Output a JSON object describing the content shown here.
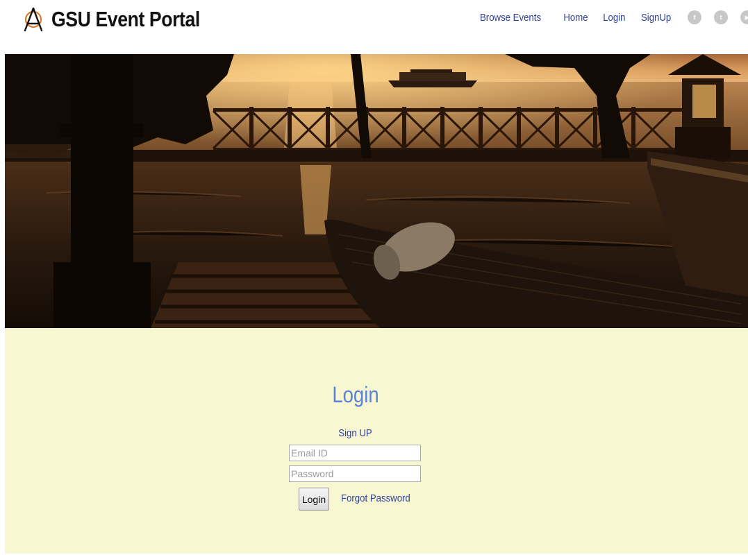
{
  "header": {
    "brand_title": "GSU Event Portal",
    "logo_icon": "compass-a-icon",
    "nav": [
      {
        "label": "Browse Events"
      },
      {
        "label": "Home"
      },
      {
        "label": "Login"
      },
      {
        "label": "SignUp"
      }
    ],
    "social": [
      {
        "icon": "facebook-icon",
        "glyph": "f"
      },
      {
        "icon": "twitter-icon",
        "glyph": "t"
      },
      {
        "icon": "youtube-icon",
        "glyph": "▶"
      }
    ]
  },
  "hero": {
    "image": "sunset-pool-photo"
  },
  "login": {
    "title": "Login",
    "signup_label": "Sign UP",
    "email_placeholder": "Email ID",
    "password_placeholder": "Password",
    "login_button": "Login",
    "forgot_label": "Forgot Password"
  },
  "colors": {
    "nav_link": "#2e3f9a",
    "title_blue": "#5b82d6",
    "section_bg": "#f7f7d2",
    "social_gray": "#c7c7c7",
    "logo_orange": "#e07a2a"
  }
}
